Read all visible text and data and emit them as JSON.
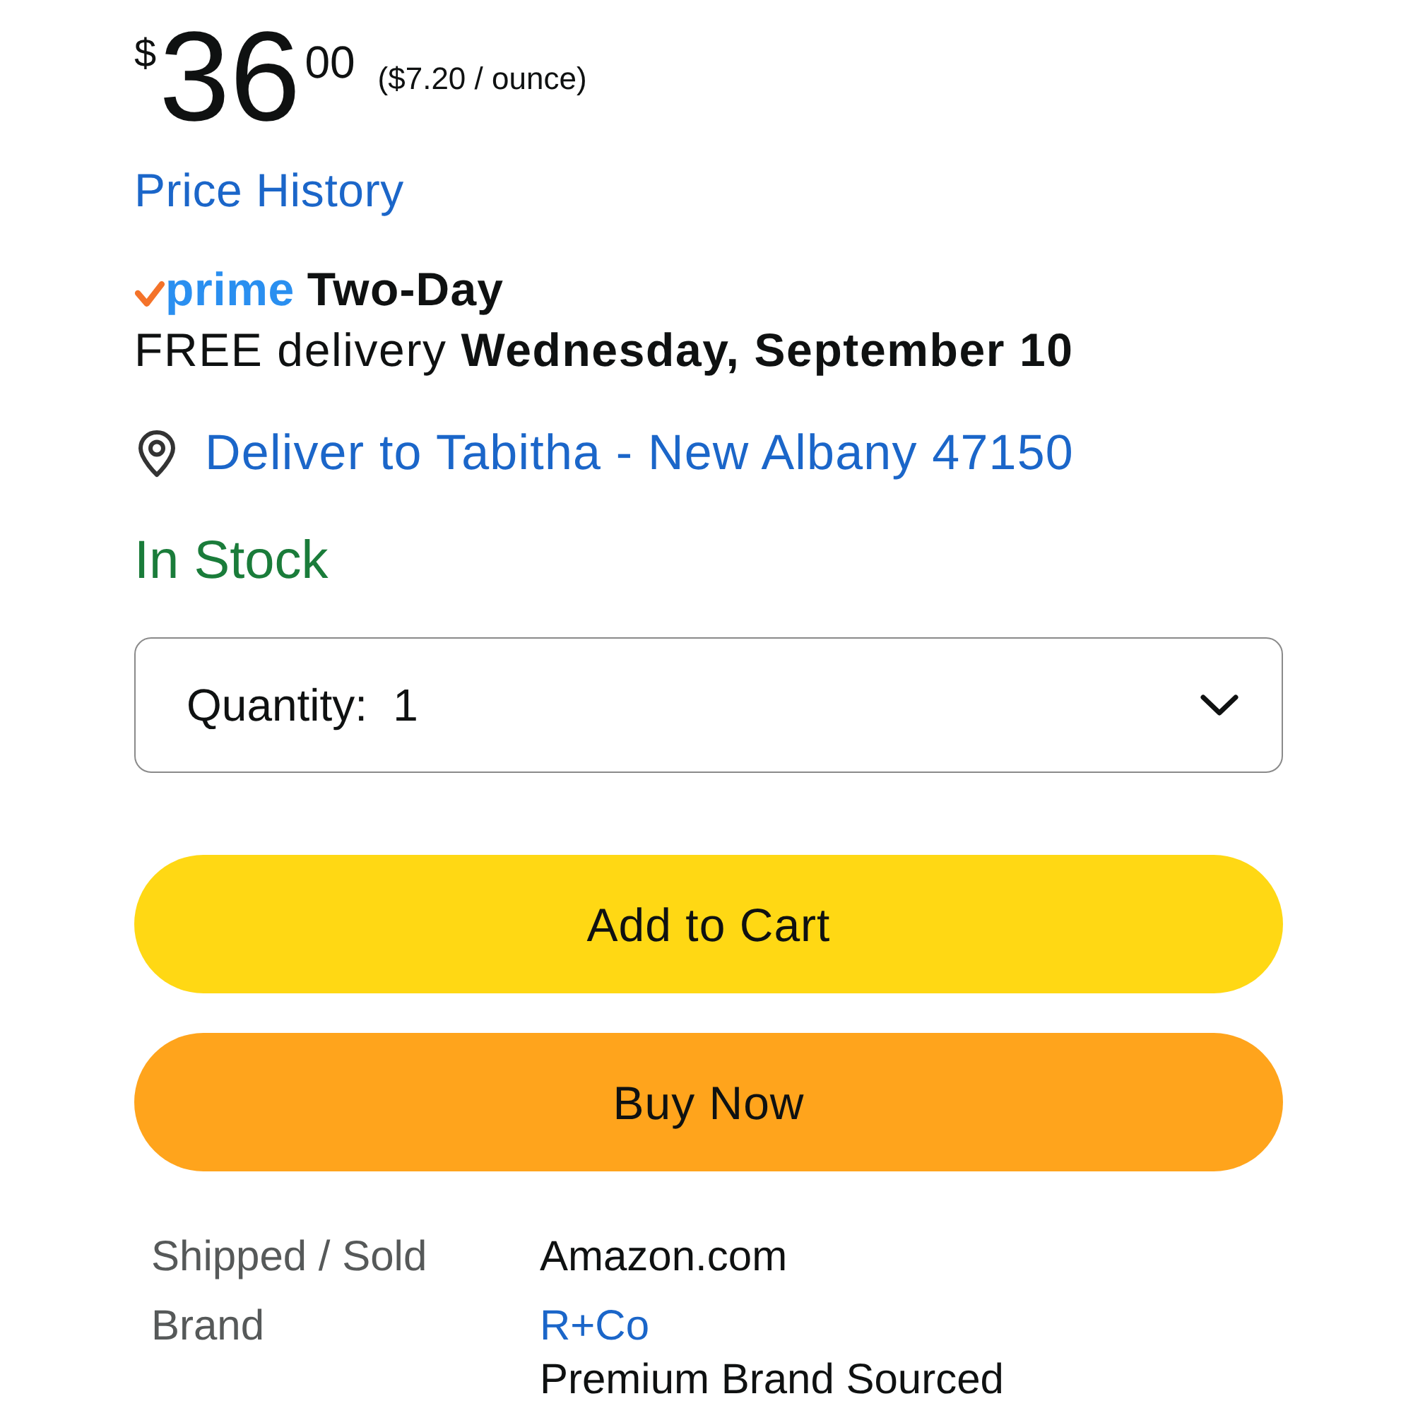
{
  "price": {
    "currency": "$",
    "whole": "36",
    "fraction": "00",
    "unit_price": "($7.20 / ounce)"
  },
  "price_history_link": "Price History",
  "delivery": {
    "prime_logo": "prime",
    "speed": "Two-Day",
    "text": "FREE delivery **Wednesday, September 10**"
  },
  "location": {
    "text": "Deliver to Tabitha - New Albany 47150"
  },
  "availability": "In Stock",
  "quantity": {
    "label": "Quantity:",
    "value": "1"
  },
  "buttons": [
    {
      "kind": "cart",
      "label": "Add to Cart"
    },
    {
      "kind": "buy",
      "label": "Buy Now"
    }
  ],
  "details": [
    {
      "label": "Shipped / Sold",
      "values": [
        {
          "kind": "text",
          "text": "Amazon.com"
        }
      ]
    },
    {
      "label": "Brand",
      "values": [
        {
          "kind": "link",
          "text": "R+Co"
        },
        {
          "kind": "text",
          "text": "Premium Brand Sourced"
        }
      ]
    }
  ]
}
